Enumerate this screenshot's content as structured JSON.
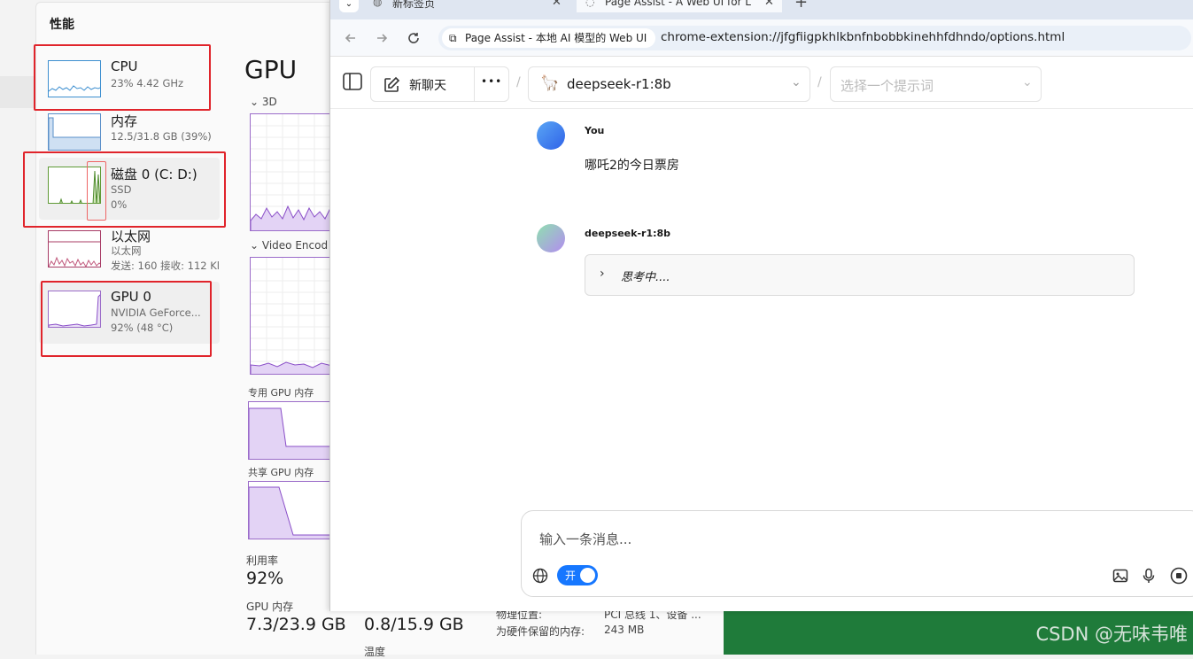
{
  "task_manager": {
    "title": "性能",
    "items": [
      {
        "name": "CPU",
        "sub1": "23% 4.42 GHz",
        "sub2": ""
      },
      {
        "name": "内存",
        "sub1": "12.5/31.8 GB (39%)",
        "sub2": ""
      },
      {
        "name": "磁盘 0 (C: D:)",
        "sub1": "SSD",
        "sub2": "0%"
      },
      {
        "name": "以太网",
        "sub1": "以太网",
        "sub2": "发送: 160 接收: 112 Kl"
      },
      {
        "name": "GPU 0",
        "sub1": "NVIDIA GeForce...",
        "sub2": "92% (48 °C)"
      }
    ],
    "detail": {
      "heading": "GPU",
      "engine_3d": "3D",
      "engine_video": "Video Encod",
      "dedicated_label": "专用 GPU 内存",
      "shared_label": "共享 GPU 内存",
      "util_label": "利用率",
      "util_value": "92%",
      "gpu_mem_label": "GPU 内存",
      "gpu_mem_value": "7.3/23.9 GB",
      "shared_mem_value": "0.8/15.9 GB",
      "temp_label": "温度",
      "location_label": "物理位置:",
      "location_value": "PCI 总线 1、设备 ...",
      "reserved_label": "为硬件保留的内存:",
      "reserved_value": "243 MB"
    }
  },
  "browser": {
    "tabs": [
      {
        "label": "新标签页"
      },
      {
        "label": "Page Assist - A Web UI for L"
      }
    ],
    "site_chip": "Page Assist - 本地 AI 模型的 Web UI",
    "url": "chrome-extension://jfgfiigpkhlkbnfnbobbkinehhfdhndo/options.html"
  },
  "app": {
    "new_chat": "新聊天",
    "more": "•••",
    "model": "deepseek-r1:8b",
    "prompt_placeholder": "选择一个提示词",
    "messages": [
      {
        "author": "You",
        "text": "哪吒2的今日票房"
      },
      {
        "author": "deepseek-r1:8b",
        "thinking": "思考中...."
      }
    ],
    "composer_placeholder": "输入一条消息...",
    "toggle_label": "开"
  },
  "watermark": "CSDN @无味韦唯",
  "colors": {
    "accent": "#1677ff",
    "highlight_red": "#e0242b",
    "gpu_purple": "#9b6cc9"
  }
}
